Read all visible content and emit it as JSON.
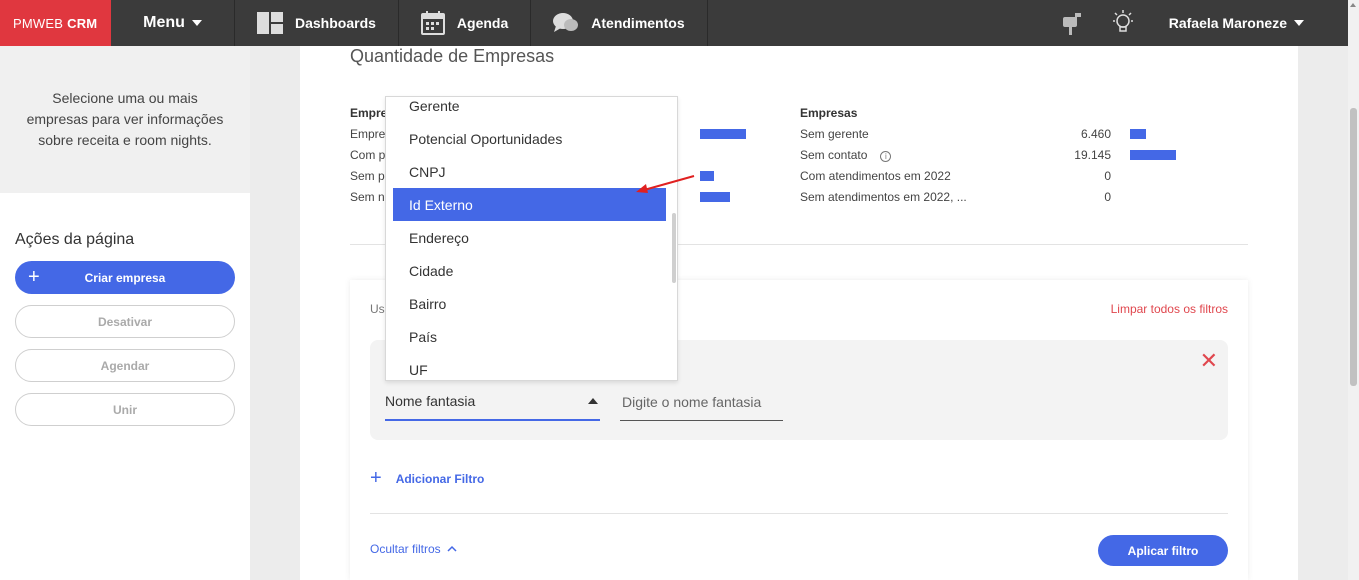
{
  "topbar": {
    "brand_prefix": "PMWEB",
    "brand_suffix": "CRM",
    "menu_label": "Menu",
    "nav": [
      {
        "label": "Dashboards",
        "icon": "dashboard-icon"
      },
      {
        "label": "Agenda",
        "icon": "calendar-icon"
      },
      {
        "label": "Atendimentos",
        "icon": "chat-icon"
      }
    ],
    "user_name": "Rafaela Maroneze"
  },
  "sidebar": {
    "info_text": "Selecione uma ou mais empresas para ver informações sobre receita e room nights.",
    "actions_title": "Ações da página",
    "create_label": "Criar empresa",
    "deactivate_label": "Desativar",
    "schedule_label": "Agendar",
    "merge_label": "Unir"
  },
  "card": {
    "title": "Quantidade de Empresas",
    "left_stats": {
      "heading": "Empre",
      "rows": [
        {
          "label": "Empre",
          "bar_fraction": 0.35
        },
        {
          "label": "Com p",
          "bar_fraction": 0
        },
        {
          "label": "Sem p",
          "bar_fraction": 0.11
        },
        {
          "label": "Sem n",
          "bar_fraction": 0.23
        }
      ]
    },
    "right_stats": {
      "heading": "Empresas",
      "rows": [
        {
          "label": "Sem gerente",
          "value": "6.460",
          "bar_fraction": 0.34
        },
        {
          "label": "Sem contato",
          "value": "19.145",
          "bar_fraction": 1.0
        },
        {
          "label": "Com atendimentos em 2022",
          "value": "0",
          "bar_fraction": 0
        },
        {
          "label": "Sem atendimentos em 2022, ...",
          "value": "0",
          "bar_fraction": 0
        }
      ]
    }
  },
  "filters": {
    "use_text": "Us",
    "clear_all_label": "Limpar todos os filtros",
    "selected_field": "Nome fantasia",
    "value_placeholder": "Digite o nome fantasia",
    "add_filter_label": "Adicionar Filtro",
    "hide_filters_label": "Ocultar filtros",
    "apply_label": "Aplicar filtro"
  },
  "dropdown": {
    "options": [
      "Gerente",
      "Potencial Oportunidades",
      "CNPJ",
      "Id Externo",
      "Endereço",
      "Cidade",
      "Bairro",
      "País",
      "UF"
    ],
    "active_index": 3
  },
  "colors": {
    "brand": "#e0373f",
    "accent": "#4468e6",
    "danger": "#e0474e",
    "topbar": "#3b3b3b"
  }
}
